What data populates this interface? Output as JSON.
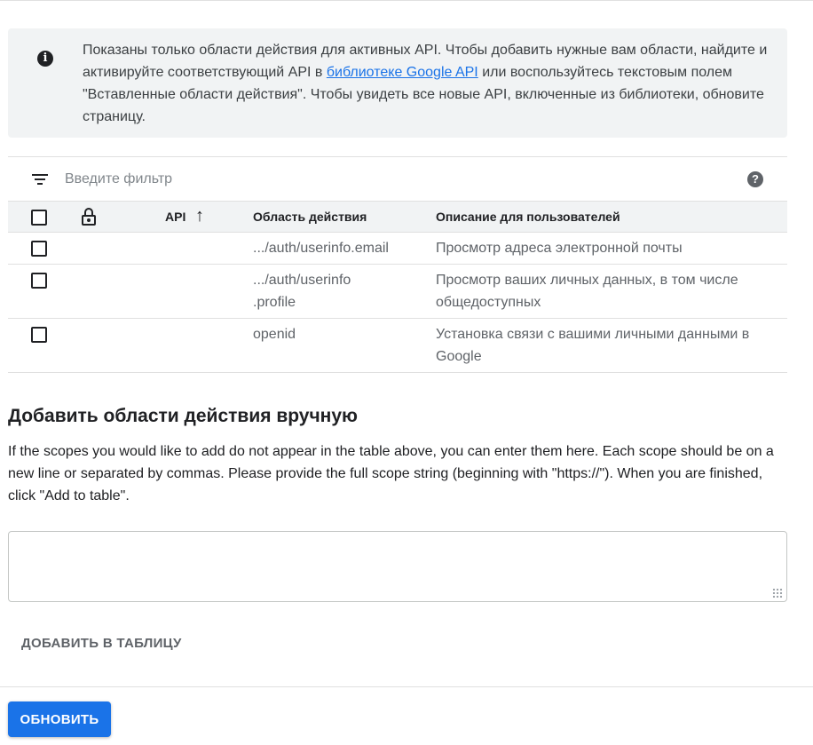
{
  "info": {
    "text_before_link": "Показаны только области действия для активных API. Чтобы добавить нужные вам области, найдите и активируйте соответствующий API в ",
    "link_text": "библиотеке Google API",
    "text_after_link": " или воспользуйтесь текстовым полем \"Вставленные области действия\". Чтобы увидеть все новые API, включенные из библиотеки, обновите страницу.",
    "icon": "info-icon"
  },
  "filter": {
    "placeholder": "Введите фильтр",
    "help_glyph": "?"
  },
  "table": {
    "columns": {
      "api": "API",
      "scope": "Область действия",
      "description": "Описание для пользователей"
    },
    "sort_glyph": "↑",
    "rows": [
      {
        "scope": ".../auth/userinfo.email",
        "description": "Просмотр адреса электронной почты"
      },
      {
        "scope": ".../auth/userinfo .profile",
        "description": "Просмотр ваших личных данных, в том числе общедоступных"
      },
      {
        "scope": "openid",
        "description": "Установка связи с вашими личными данными в Google"
      }
    ]
  },
  "manual": {
    "title": "Добавить области действия вручную",
    "description": "If the scopes you would like to add do not appear in the table above, you can enter them here. Each scope should be on a new line or separated by commas. Please provide the full scope string (beginning with \"https://\"). When you are finished, click \"Add to table\".",
    "textarea_value": "",
    "add_button": "ДОБАВИТЬ В ТАБЛИЦУ"
  },
  "footer": {
    "update_button": "ОБНОВИТЬ"
  },
  "colors": {
    "accent": "#1a73e8",
    "info_bg": "#f1f3f4",
    "divider": "#e0e0e0"
  }
}
